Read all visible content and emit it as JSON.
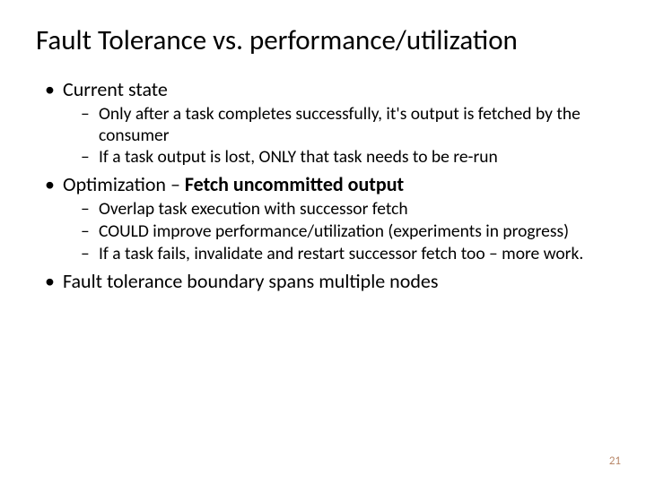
{
  "title": "Fault Tolerance vs. performance/utilization",
  "bullets": {
    "b1": "Current state",
    "b1_1": "Only after a task completes successfully, it's output is fetched by the consumer",
    "b1_2": "If a task output is lost, ONLY that task needs to be re-run",
    "b2_pre": "Optimization – ",
    "b2_emph": "Fetch uncommitted output",
    "b2_1": "Overlap task execution with successor fetch",
    "b2_2": "COULD improve performance/utilization (experiments in progress)",
    "b2_3": "If a task fails, invalidate and restart successor fetch too – more work.",
    "b3": "Fault tolerance boundary spans multiple nodes"
  },
  "page_number": "21"
}
